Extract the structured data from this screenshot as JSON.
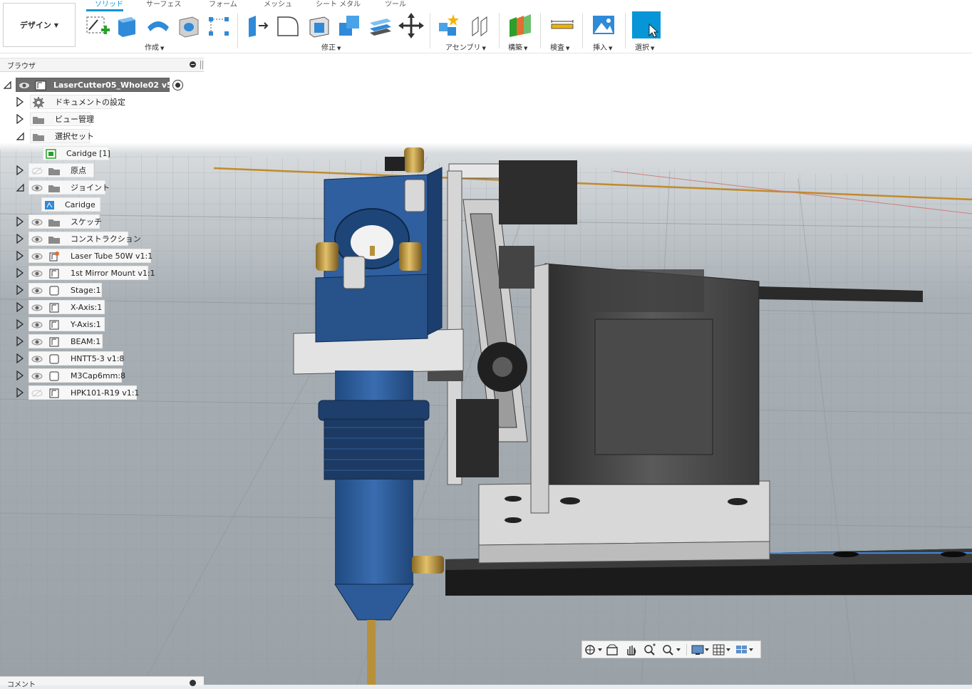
{
  "toolbar": {
    "workspace": "デザイン",
    "tabs": [
      "ソリッド",
      "サーフェス",
      "フォーム",
      "メッシュ",
      "シート メタル",
      "ツール"
    ],
    "active_tab": "ソリッド",
    "groups": [
      {
        "label": "作成",
        "icons": [
          "new-sketch-icon",
          "extrude-icon",
          "revolve-icon",
          "hole-icon",
          "pattern-icon"
        ]
      },
      {
        "label": "修正",
        "icons": [
          "press-pull-icon",
          "fillet-icon",
          "shell-icon",
          "combine-icon",
          "offset-face-icon",
          "move-icon"
        ]
      },
      {
        "label": "アセンブリ",
        "icons": [
          "new-component-icon",
          "joint-icon"
        ]
      },
      {
        "label": "構築",
        "icons": [
          "offset-plane-icon"
        ]
      },
      {
        "label": "検査",
        "icons": [
          "measure-icon"
        ]
      },
      {
        "label": "挿入",
        "icons": [
          "insert-image-icon"
        ]
      },
      {
        "label": "選択",
        "icons": [
          "select-icon"
        ]
      }
    ]
  },
  "browser": {
    "title": "ブラウザ",
    "root": "LaserCutter05_Whole02 v5",
    "items": [
      {
        "label": "ドキュメントの設定",
        "icon": "gear-icon",
        "eye": "none",
        "expander": "collapsed"
      },
      {
        "label": "ビュー管理",
        "icon": "folder-icon",
        "eye": "none",
        "expander": "collapsed"
      },
      {
        "label": "選択セット",
        "icon": "folder-icon",
        "eye": "none",
        "expander": "expanded"
      },
      {
        "label": "Caridge [1]",
        "icon": "selection-set-icon",
        "eye": "none",
        "expander": "none"
      },
      {
        "label": "原点",
        "icon": "folder-icon",
        "eye": "hidden",
        "expander": "collapsed"
      },
      {
        "label": "ジョイント",
        "icon": "folder-icon",
        "eye": "visible",
        "expander": "expanded"
      },
      {
        "label": "Caridge",
        "icon": "joint-item-icon",
        "eye": "none",
        "expander": "none"
      },
      {
        "label": "スケッチ",
        "icon": "folder-icon",
        "eye": "visible",
        "expander": "collapsed"
      },
      {
        "label": "コンストラクション",
        "icon": "folder-icon",
        "eye": "visible",
        "expander": "collapsed"
      },
      {
        "label": "Laser Tube 50W v1:1",
        "icon": "linked-component-icon",
        "eye": "visible",
        "expander": "collapsed"
      },
      {
        "label": "1st Mirror Mount v1:1",
        "icon": "component-icon",
        "eye": "visible",
        "expander": "collapsed"
      },
      {
        "label": "Stage:1",
        "icon": "body-icon",
        "eye": "visible",
        "expander": "collapsed"
      },
      {
        "label": "X-Axis:1",
        "icon": "component-icon",
        "eye": "visible",
        "expander": "collapsed"
      },
      {
        "label": "Y-Axis:1",
        "icon": "component-icon",
        "eye": "visible",
        "expander": "collapsed"
      },
      {
        "label": "BEAM:1",
        "icon": "component-icon",
        "eye": "visible",
        "expander": "collapsed"
      },
      {
        "label": "HNTT5-3 v1:8",
        "icon": "body-icon",
        "eye": "visible",
        "expander": "collapsed"
      },
      {
        "label": "M3Cap6mm:8",
        "icon": "body-icon",
        "eye": "visible",
        "expander": "collapsed"
      },
      {
        "label": "HPK101-R19 v1:1",
        "icon": "component-icon",
        "eye": "hidden",
        "expander": "collapsed"
      }
    ]
  },
  "comments": {
    "title": "コメント"
  },
  "navbar": {
    "icons": [
      "orbit-icon",
      "look-at-icon",
      "pan-icon",
      "zoom-icon",
      "fit-icon",
      "display-settings-icon",
      "grid-settings-icon",
      "viewports-icon"
    ]
  },
  "colors": {
    "accent": "#0696d7",
    "part_blue": "#2f5f9e",
    "brass": "#b8903a",
    "motor_dark": "#3a3a3a"
  }
}
